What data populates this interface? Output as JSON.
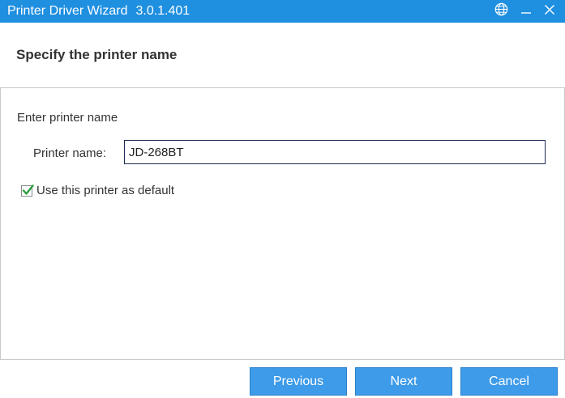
{
  "window": {
    "title": "Printer Driver Wizard",
    "version": "3.0.1.401",
    "accent_color": "#1f8fe0"
  },
  "titlebar_icons": [
    "globe-icon",
    "minimize-icon",
    "close-icon"
  ],
  "header": {
    "title": "Specify the printer name"
  },
  "content": {
    "section_label": "Enter printer name",
    "printer_name_label": "Printer name:",
    "printer_name_value": "JD-268BT",
    "default_checkbox_label": "Use this printer as default",
    "default_checked": true
  },
  "buttons": {
    "previous": "Previous",
    "next": "Next",
    "cancel": "Cancel",
    "color": "#3d9be9"
  }
}
